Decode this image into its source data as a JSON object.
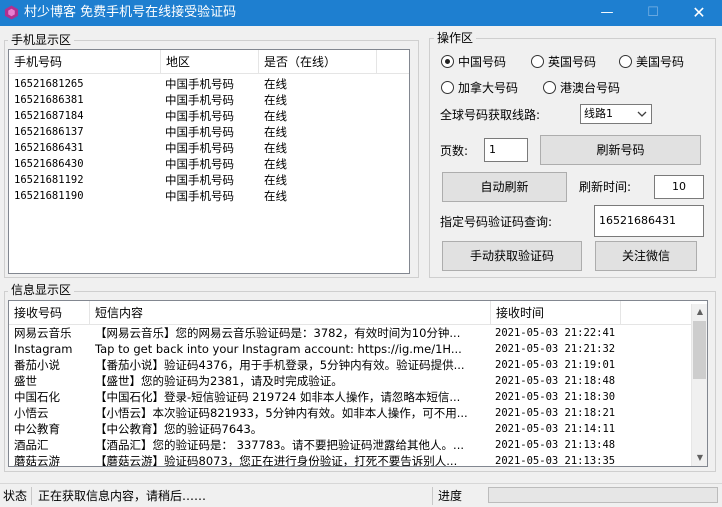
{
  "window": {
    "title": "村少博客 免费手机号在线接受验证码",
    "minimize": "—",
    "maximize": "☐",
    "close": "✕"
  },
  "colors": {
    "titlebar": "#1e7fd0",
    "progress": "#06b025",
    "app_icon": "#b03090"
  },
  "phone_group": {
    "legend": "手机显示区",
    "columns": [
      "手机号码",
      "地区",
      "是否（在线）"
    ],
    "rows": [
      [
        "16521681265",
        "中国手机号码",
        "在线"
      ],
      [
        "16521686381",
        "中国手机号码",
        "在线"
      ],
      [
        "16521687184",
        "中国手机号码",
        "在线"
      ],
      [
        "16521686137",
        "中国手机号码",
        "在线"
      ],
      [
        "16521686431",
        "中国手机号码",
        "在线"
      ],
      [
        "16521686430",
        "中国手机号码",
        "在线"
      ],
      [
        "16521681192",
        "中国手机号码",
        "在线"
      ],
      [
        "16521681190",
        "中国手机号码",
        "在线"
      ]
    ]
  },
  "ops_group": {
    "legend": "操作区",
    "radios": [
      {
        "label": "中国号码",
        "checked": true
      },
      {
        "label": "英国号码",
        "checked": false
      },
      {
        "label": "美国号码",
        "checked": false
      },
      {
        "label": "加拿大号码",
        "checked": false
      },
      {
        "label": "港澳台号码",
        "checked": false
      }
    ],
    "route_label": "全球号码获取线路:",
    "route_value": "线路1",
    "page_label": "页数:",
    "page_value": "1",
    "refresh_number_button": "刷新号码",
    "auto_refresh_button": "自动刷新",
    "refresh_time_label": "刷新时间:",
    "refresh_time_value": "10",
    "query_label": "指定号码验证码查询:",
    "query_value": "16521686431",
    "manual_fetch_button": "手动获取验证码",
    "follow_wechat_button": "关注微信"
  },
  "info_group": {
    "legend": "信息显示区",
    "columns": [
      "接收号码",
      "短信内容",
      "接收时间"
    ],
    "rows": [
      [
        "网易云音乐",
        "【网易云音乐】您的网易云音乐验证码是：3782，有效时间为10分钟...",
        "2021-05-03 21:22:41"
      ],
      [
        "Instagram",
        "Tap to get back into your Instagram account: https://ig.me/1H...",
        "2021-05-03 21:21:32"
      ],
      [
        "番茄小说",
        "【番茄小说】验证码4376，用于手机登录，5分钟内有效。验证码提供...",
        "2021-05-03 21:19:01"
      ],
      [
        "盛世",
        "【盛世】您的验证码为2381，请及时完成验证。",
        "2021-05-03 21:18:48"
      ],
      [
        "中国石化",
        "【中国石化】登录-短信验证码 219724 如非本人操作，请忽略本短信...",
        "2021-05-03 21:18:30"
      ],
      [
        "小悟云",
        "【小悟云】本次验证码821933，5分钟内有效。如非本人操作，可不用...",
        "2021-05-03 21:18:21"
      ],
      [
        "中公教育",
        "【中公教育】您的验证码7643。",
        "2021-05-03 21:14:11"
      ],
      [
        "酒品汇",
        "【酒品汇】您的验证码是： 337783。请不要把验证码泄露给其他人。...",
        "2021-05-03 21:13:48"
      ],
      [
        "蘑菇云游",
        "【蘑菇云游】验证码8073，您正在进行身份验证，打死不要告诉别人...",
        "2021-05-03 21:13:35"
      ]
    ],
    "scroll_up": "▲",
    "scroll_down": "▼"
  },
  "status": {
    "label": "状态",
    "message": "正在获取信息内容，请稍后……",
    "progress_label": "进度",
    "progress": 0
  }
}
